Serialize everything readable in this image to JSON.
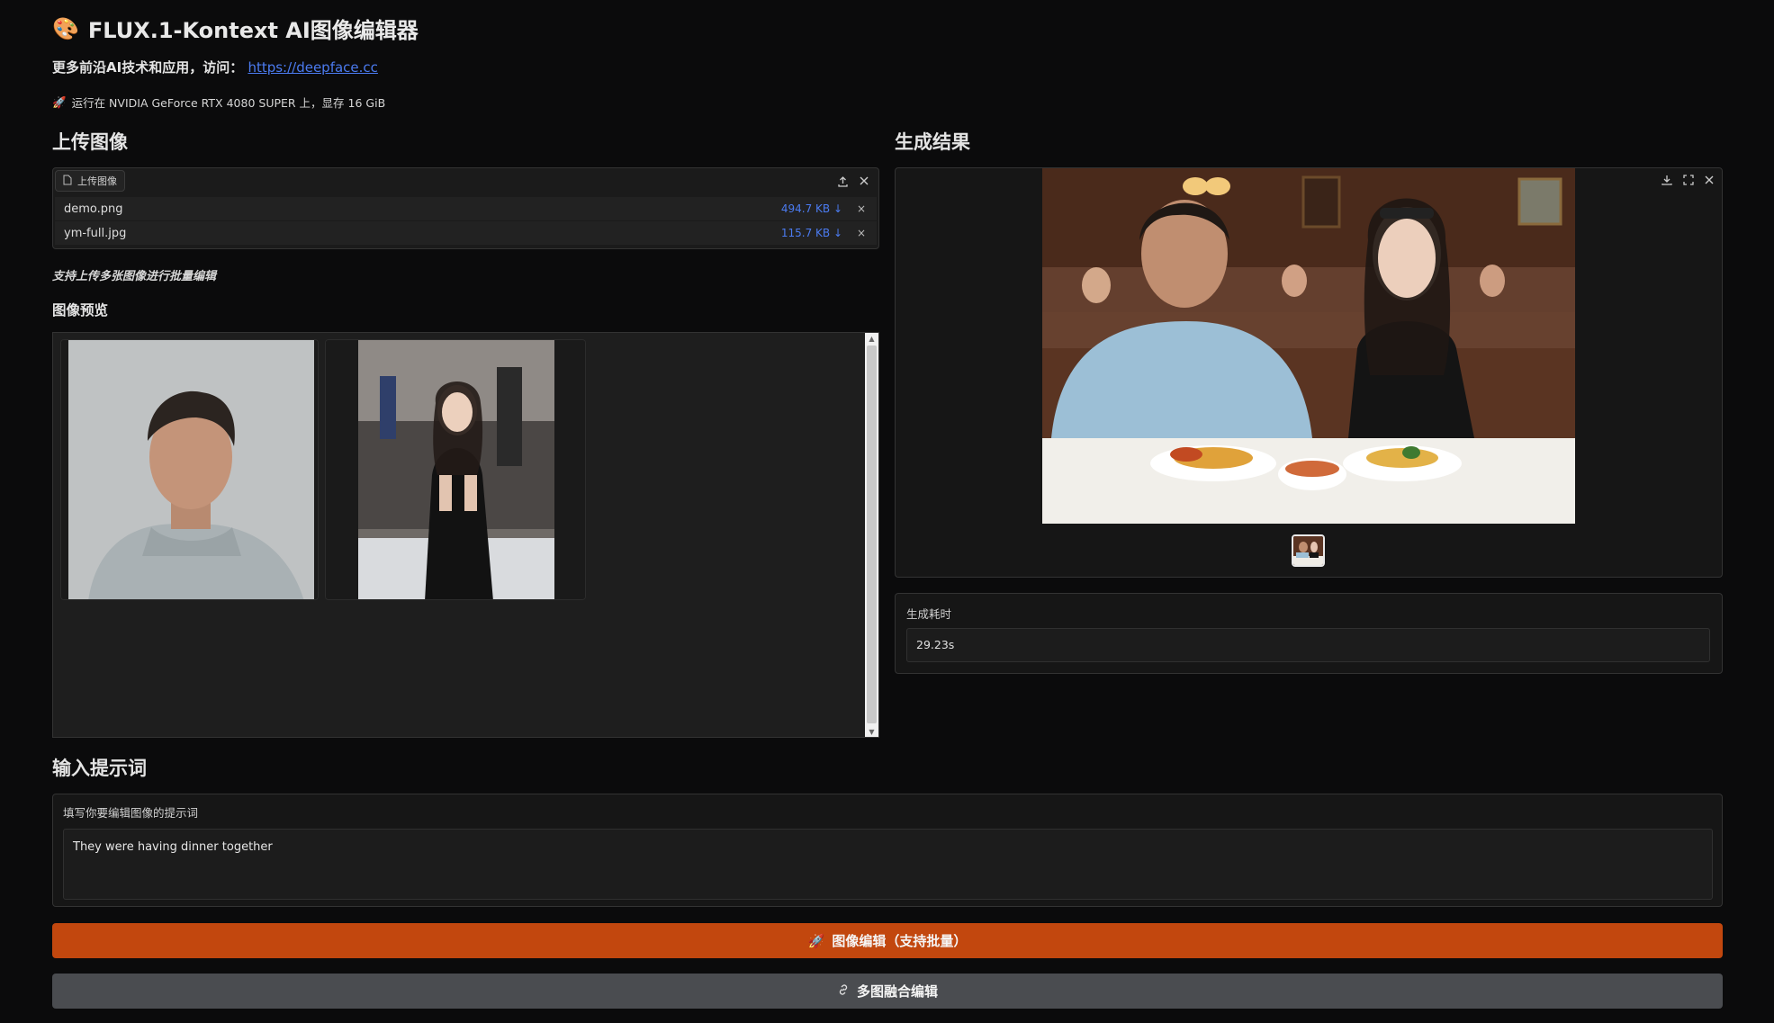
{
  "header": {
    "title": "FLUX.1-Kontext AI图像编辑器",
    "subline_text": "更多前沿AI技术和应用，访问：",
    "subline_link": "https://deepface.cc",
    "gpu_info": "运行在 NVIDIA GeForce RTX 4080 SUPER 上，显存 16 GiB"
  },
  "upload": {
    "section_title": "上传图像",
    "tab_label": "上传图像",
    "files": [
      {
        "name": "demo.png",
        "size": "494.7 KB ↓",
        "remove": "×"
      },
      {
        "name": "ym-full.jpg",
        "size": "115.7 KB ↓",
        "remove": "×"
      }
    ],
    "hint": "支持上传多张图像进行批量编辑",
    "preview_title": "图像预览"
  },
  "result": {
    "section_title": "生成结果",
    "time_label": "生成耗时",
    "time_value": "29.23s"
  },
  "prompt": {
    "section_title": "输入提示词",
    "label": "填写你要编辑图像的提示词",
    "value": "They were having dinner together"
  },
  "buttons": {
    "edit": "图像编辑（支持批量）",
    "merge": "多图融合编辑"
  },
  "colors": {
    "primary": "#c2470e",
    "secondary": "#4a4c50",
    "link": "#4b7bf0",
    "background": "#0b0b0c"
  },
  "icons": [
    "palette-icon",
    "rocket-icon",
    "file-icon",
    "upload-icon",
    "close-icon",
    "download-icon",
    "fullscreen-icon",
    "link-icon"
  ]
}
